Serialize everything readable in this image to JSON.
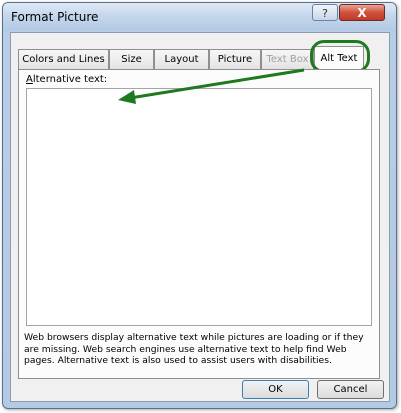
{
  "window": {
    "title": "Format Picture",
    "help_label": "?",
    "close_label": "X"
  },
  "tabs": [
    {
      "label": "Colors and Lines",
      "state": "normal"
    },
    {
      "label": "Size",
      "state": "normal"
    },
    {
      "label": "Layout",
      "state": "normal"
    },
    {
      "label": "Picture",
      "state": "normal"
    },
    {
      "label": "Text Box",
      "state": "disabled"
    },
    {
      "label": "Alt Text",
      "state": "active"
    }
  ],
  "alt_text": {
    "label_mnemonic": "A",
    "label_rest": "lternative text:",
    "value": "",
    "description": "Web browsers display alternative text while pictures are loading or if they are missing. Web search engines use alternative text to help find Web pages. Alternative text is also used to assist users with disabilities."
  },
  "buttons": {
    "ok": "OK",
    "cancel": "Cancel"
  },
  "annotation": {
    "color": "#1f7a1f"
  }
}
